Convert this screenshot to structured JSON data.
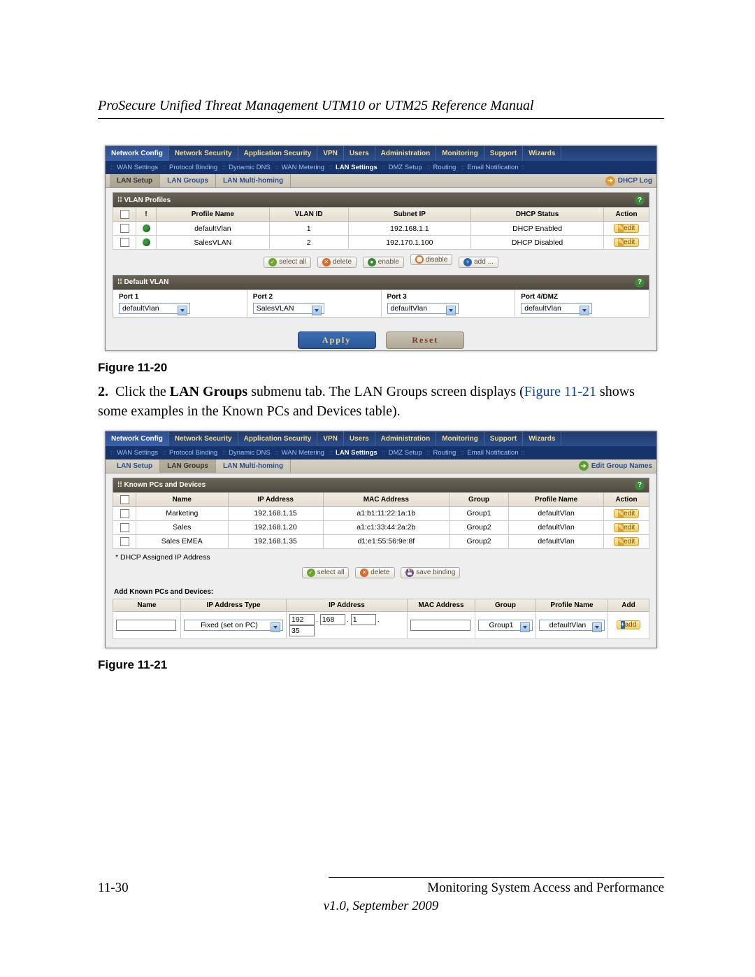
{
  "doc": {
    "title": "ProSecure Unified Threat Management UTM10 or UTM25 Reference Manual",
    "page_num": "11-30",
    "footer_right": "Monitoring System Access and Performance",
    "version": "v1.0, September 2009"
  },
  "fig1": {
    "caption": "Figure 11-20",
    "main_tabs": [
      "Network Config",
      "Network Security",
      "Application Security",
      "VPN",
      "Users",
      "Administration",
      "Monitoring",
      "Support",
      "Wizards"
    ],
    "main_active": 0,
    "sub_tabs": [
      "WAN Settings",
      "Protocol Binding",
      "Dynamic DNS",
      "WAN Metering",
      "LAN Settings",
      "DMZ Setup",
      "Routing",
      "Email Notification"
    ],
    "sub_active": 4,
    "tert_tabs": [
      "LAN Setup",
      "LAN Groups",
      "LAN Multi-homing"
    ],
    "tert_active": 0,
    "right_link": "DHCP Log",
    "section1_title": "VLAN Profiles",
    "cols": [
      "!",
      "Profile Name",
      "VLAN ID",
      "Subnet IP",
      "DHCP Status",
      "Action"
    ],
    "rows": [
      {
        "name": "defaultVlan",
        "id": "1",
        "ip": "192.168.1.1",
        "dhcp": "DHCP Enabled",
        "edit": "edit"
      },
      {
        "name": "SalesVLAN",
        "id": "2",
        "ip": "192.170.1.100",
        "dhcp": "DHCP Disabled",
        "edit": "edit"
      }
    ],
    "pills": [
      "select all",
      "delete",
      "enable",
      "disable",
      "add ..."
    ],
    "section2_title": "Default VLAN",
    "ports": [
      {
        "label": "Port 1",
        "sel": "defaultVlan"
      },
      {
        "label": "Port 2",
        "sel": "SalesVLAN"
      },
      {
        "label": "Port 3",
        "sel": "defaultVlan"
      },
      {
        "label": "Port 4/DMZ",
        "sel": "defaultVlan"
      }
    ],
    "apply": "Apply",
    "reset": "Reset"
  },
  "body": {
    "num": "2.",
    "pre": "Click the ",
    "bold": "LAN Groups",
    "mid": " submenu tab. The LAN Groups screen displays (",
    "link": "Figure 11-21",
    "post": " shows some examples in the Known PCs and Devices table)."
  },
  "fig2": {
    "caption": "Figure 11-21",
    "tert_active": 1,
    "right_link": "Edit Group Names",
    "section_title": "Known PCs and Devices",
    "cols": [
      "Name",
      "IP Address",
      "MAC Address",
      "Group",
      "Profile Name",
      "Action"
    ],
    "rows": [
      {
        "name": "Marketing",
        "ip": "192.168.1.15",
        "mac": "a1:b1:11:22:1a:1b",
        "grp": "Group1",
        "prof": "defaultVlan"
      },
      {
        "name": "Sales",
        "ip": "192.168.1.20",
        "mac": "a1:c1:33:44:2a:2b",
        "grp": "Group2",
        "prof": "defaultVlan"
      },
      {
        "name": "Sales EMEA",
        "ip": "192.168.1.35",
        "mac": "d1:e1:55:56:9e:8f",
        "grp": "Group2",
        "prof": "defaultVlan"
      }
    ],
    "note": "* DHCP Assigned IP Address",
    "pills": [
      "select all",
      "delete",
      "save binding"
    ],
    "add_title": "Add Known PCs and Devices:",
    "add_cols": [
      "Name",
      "IP Address Type",
      "IP Address",
      "MAC Address",
      "Group",
      "Profile Name",
      "Add"
    ],
    "add_row": {
      "type": "Fixed (set on PC)",
      "ip": [
        "192",
        "168",
        "1",
        "35"
      ],
      "grp": "Group1",
      "prof": "defaultVlan",
      "btn": "add"
    },
    "edit": "edit"
  }
}
